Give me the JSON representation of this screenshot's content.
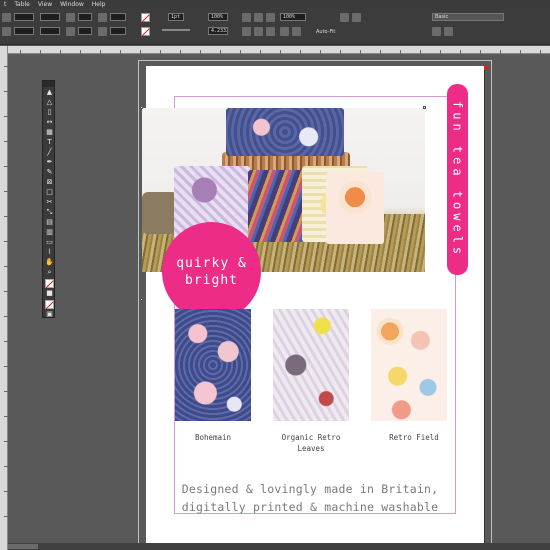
{
  "menu": {
    "items": [
      "t",
      "Table",
      "View",
      "Window",
      "Help"
    ]
  },
  "control_panel": {
    "stroke_weight": "1pt",
    "zoom": "100%",
    "opacity": "100%",
    "auto_fit": "Auto-Fit",
    "font_field": "Basic",
    "value_field": "4.2333 mm",
    "colors": {
      "none_swatch": "#ffffff",
      "stroke_black": "#000000"
    }
  },
  "tools": {
    "icons": [
      "selection-icon",
      "direct-selection-icon",
      "page-icon",
      "gap-icon",
      "content-collector-icon",
      "type-icon",
      "line-icon",
      "pen-icon",
      "pencil-icon",
      "rectangle-frame-icon",
      "rectangle-icon",
      "scissors-icon",
      "free-transform-icon",
      "gradient-swatch-icon",
      "gradient-feather-icon",
      "note-icon",
      "eyedropper-icon",
      "hand-icon",
      "zoom-icon"
    ]
  },
  "document": {
    "hero_photo": "hero-photo",
    "circle_badge": {
      "line1": "quirky &",
      "line2": "bright"
    },
    "vertical_badge": "fun tea towels",
    "products": [
      {
        "caption": "Bohemain"
      },
      {
        "caption_line1": "Organic Retro",
        "caption_line2": "Leaves"
      },
      {
        "caption": "Retro Field"
      }
    ],
    "tagline_line1": "Designed & lovingly made in Britain,",
    "tagline_line2": "digitally printed & machine washable",
    "accent_color": "#ec2c87"
  }
}
